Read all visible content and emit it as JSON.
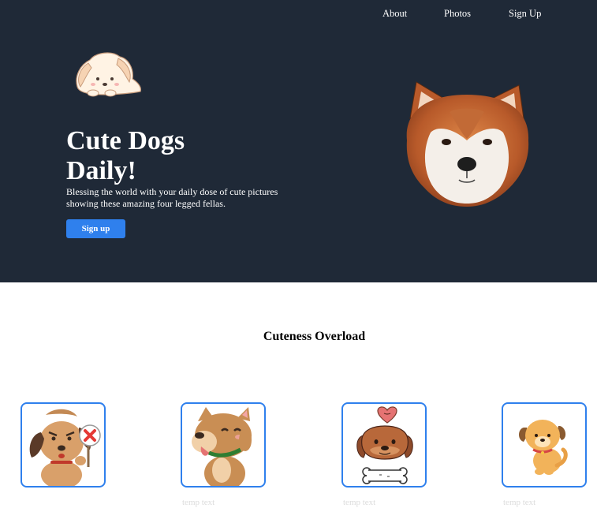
{
  "nav": {
    "items": [
      {
        "label": "About"
      },
      {
        "label": "Photos"
      },
      {
        "label": "Sign Up"
      }
    ]
  },
  "hero": {
    "title": "Cute Dogs Daily!",
    "subtitle": "Blessing the world with your daily dose of cute pictures showing these amazing four legged fellas.",
    "cta_label": "Sign up"
  },
  "gallery": {
    "title": "Cuteness Overload",
    "cards": [
      {
        "caption": "",
        "icon": "dog-refusing-icon"
      },
      {
        "caption": "temp text",
        "icon": "dog-tongue-icon"
      },
      {
        "caption": "temp text",
        "icon": "dog-heart-bone-icon"
      },
      {
        "caption": "temp text",
        "icon": "sitting-puppy-icon"
      }
    ]
  },
  "colors": {
    "hero_bg": "#1f2937",
    "accent": "#2f80ed",
    "caption": "#dcdcdc"
  }
}
